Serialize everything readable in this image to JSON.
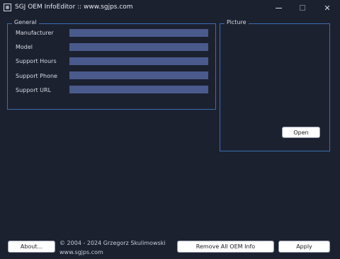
{
  "window": {
    "title": "SGJ OEM InfoEditor :: www.sgjps.com",
    "icon": "app-icon",
    "controls": [
      "minimize-icon",
      "maximize-icon",
      "close-icon"
    ],
    "close_glyph": "✕"
  },
  "general": {
    "legend": "General",
    "fields": [
      {
        "label": "Manufacturer",
        "value": ""
      },
      {
        "label": "Model",
        "value": ""
      },
      {
        "label": "Support Hours",
        "value": ""
      },
      {
        "label": "Support Phone",
        "value": ""
      },
      {
        "label": "Support URL",
        "value": ""
      }
    ]
  },
  "picture": {
    "legend": "Picture",
    "open_label": "Open"
  },
  "footer": {
    "about_label": "About...",
    "copyright": "© 2004 - 2024 Grzegorz Skulimowski",
    "url": "www.sgjps.com",
    "remove_label": "Remove All OEM Info",
    "apply_label": "Apply"
  },
  "colors": {
    "background": "#1c2130",
    "group_border": "#3a6fb0",
    "input_fill": "#4a5a8c",
    "button_fill": "#ffffff"
  }
}
